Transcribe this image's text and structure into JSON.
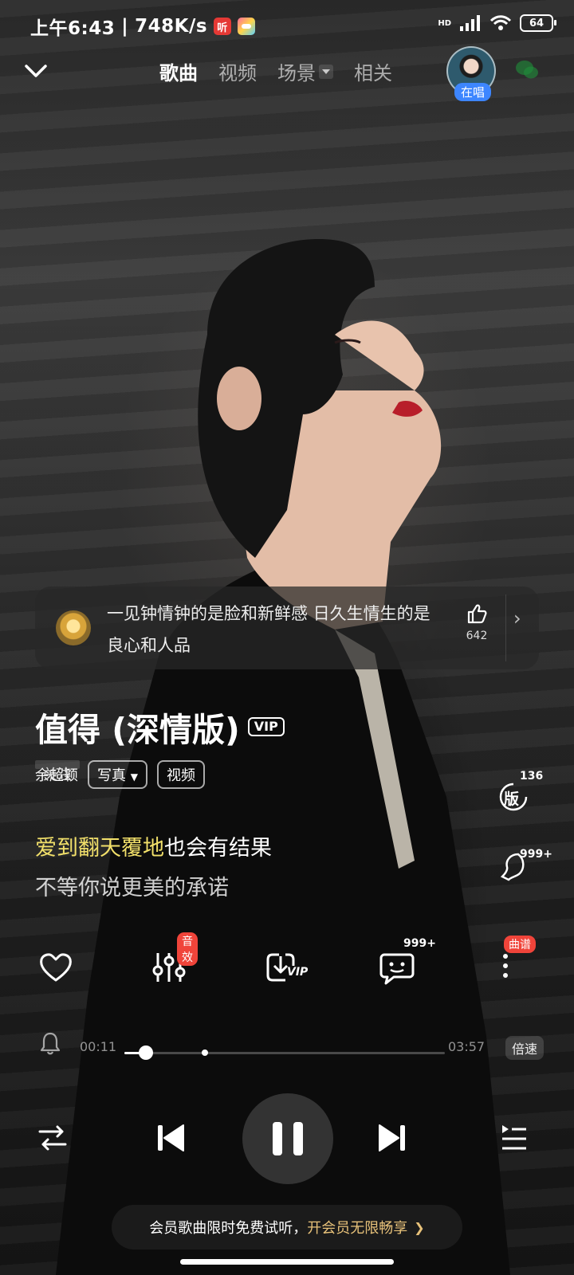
{
  "status_bar": {
    "time": "上午6:43",
    "separator": "|",
    "net_speed": "748K/s",
    "app1_glyph": "听",
    "network": "HD",
    "battery": "64"
  },
  "header": {
    "tabs": [
      {
        "label": "歌曲",
        "active": true
      },
      {
        "label": "视频",
        "active": false
      },
      {
        "label": "场景",
        "active": false
      },
      {
        "label": "相关",
        "active": false
      }
    ],
    "singing_badge": "在唱"
  },
  "comment": {
    "text": "一见钟情钟的是脸和新鲜感 日久生情生的是良心和人品",
    "like_count": "642"
  },
  "song": {
    "title": "值得 (深情版)",
    "vip_tag": "VIP",
    "artist": "余超颖",
    "follow": "关注",
    "photos": "写真",
    "video": "视频"
  },
  "side_actions": {
    "versions_glyph": "版",
    "versions_count": "136",
    "ring_count": "999+"
  },
  "lyrics": {
    "line1_highlight": "爱到翻天覆地",
    "line1_rest": "也会有结果",
    "line2": "不等你说更美的承诺"
  },
  "actions": {
    "sound_effect_badge": "音效",
    "comments_count": "999+",
    "score_badge": "曲谱",
    "download_vip": "VIP"
  },
  "progress": {
    "current": "00:11",
    "total": "03:57",
    "played_fraction": 0.066,
    "marker_fraction": 0.25,
    "speed_label": "倍速"
  },
  "vip_banner": {
    "text": "会员歌曲限时免费试听，",
    "link": "开会员无限畅享",
    "arrow": "❯"
  },
  "colors": {
    "lyric_highlight": "#f2e06a",
    "badge_red": "#f0443a",
    "singing_blue": "#3d86ff",
    "gold": "#e8c27a"
  }
}
